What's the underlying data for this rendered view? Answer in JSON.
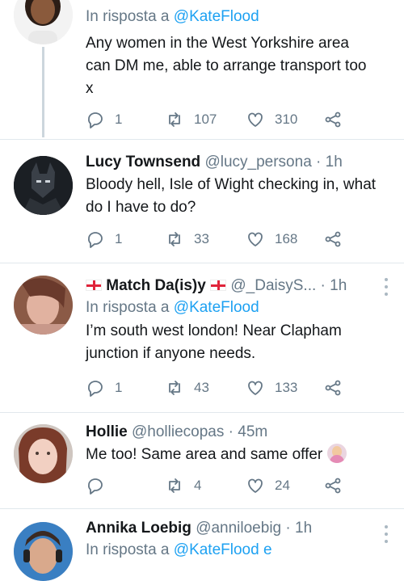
{
  "reply_prefix": "In risposta a",
  "tweets": [
    {
      "name": "",
      "handle": "",
      "time": "",
      "reply_to": "@KateFlood",
      "text": "Any women in the West Yorkshire area can DM me, able to arrange transport too x",
      "replies": "1",
      "retweets": "107",
      "likes": "310"
    },
    {
      "name": "Lucy Townsend",
      "handle": "@lucy_persona",
      "time": "1h",
      "text": "Bloody hell, Isle of Wight checking in, what do I have to do?",
      "replies": "1",
      "retweets": "33",
      "likes": "168"
    },
    {
      "name": "Match Da(is)y",
      "handle": "@_DaisyS...",
      "time": "1h",
      "reply_to": "@KateFlood",
      "text": "I’m south west london! Near Clapham junction if anyone needs.",
      "replies": "1",
      "retweets": "43",
      "likes": "133"
    },
    {
      "name": "Hollie",
      "handle": "@holliecopas",
      "time": "45m",
      "text": "Me too! Same area and same offer",
      "replies": "",
      "retweets": "4",
      "likes": "24"
    },
    {
      "name": "Annika Loebig",
      "handle": "@anniloebig",
      "time": "1h",
      "reply_to": "@KateFlood e"
    }
  ],
  "colors": {
    "accent": "#1da1f2",
    "muted": "#657786",
    "divider": "#e1e8ed"
  },
  "icons": [
    "reply-icon",
    "retweet-icon",
    "like-icon",
    "share-icon",
    "more-icon",
    "england-flag-icon",
    "woman-raising-hand-emoji"
  ]
}
